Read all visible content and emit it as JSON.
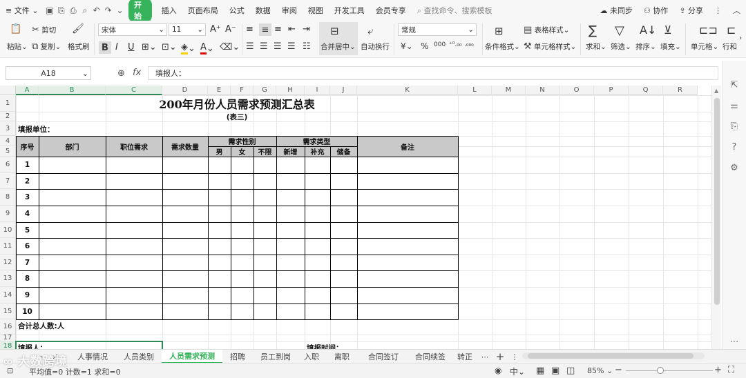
{
  "menu": {
    "file": "文件",
    "tabs": [
      "开始",
      "插入",
      "页面布局",
      "公式",
      "数据",
      "审阅",
      "视图",
      "开发工具",
      "会员专享"
    ],
    "search_placeholder": "查找命令、搜索模板",
    "right": [
      "未同步",
      "协作",
      "分享"
    ]
  },
  "ribbon": {
    "paste": "粘贴",
    "cut": "剪切",
    "copy": "复制",
    "format_painter": "格式刷",
    "font_name": "宋体",
    "font_size": "11",
    "merge_center": "合并居中",
    "wrap_text": "自动换行",
    "number_format": "常规",
    "cond_format": "条件格式",
    "table_style": "表格样式",
    "cell_style": "单元格样式",
    "sum": "求和",
    "filter": "筛选",
    "sort": "排序",
    "fill": "填充",
    "cell": "单元格",
    "row_col": "行和"
  },
  "formula": {
    "cell_ref": "A18",
    "fx": "fx",
    "content": "填报人："
  },
  "columns": [
    "A",
    "B",
    "C",
    "D",
    "E",
    "F",
    "G",
    "H",
    "I",
    "J",
    "K",
    "L",
    "M",
    "N",
    "O",
    "P",
    "Q",
    "R"
  ],
  "rows": [
    "1",
    "2",
    "3",
    "4",
    "5",
    "6",
    "7",
    "8",
    "9",
    "10",
    "11",
    "12",
    "13",
    "14",
    "15",
    "16",
    "17",
    "18"
  ],
  "sheet": {
    "title": "200年月份人员需求预测汇总表",
    "subtitle": "(表三)",
    "reporting_unit": "填报单位：",
    "headers": {
      "seq": "序号",
      "dept": "部门",
      "position": "职位需求",
      "quantity": "需求数量",
      "gender": "需求性别",
      "male": "男",
      "female": "女",
      "unlimited": "不限",
      "type": "需求类型",
      "new": "新增",
      "supplement": "补充",
      "reserve": "储备",
      "remark": "备注"
    },
    "seq_numbers": [
      "1",
      "2",
      "3",
      "4",
      "5",
      "6",
      "7",
      "8",
      "9",
      "10"
    ],
    "total": "合计总人数:人",
    "reporter": "填报人：",
    "report_time": "填报时间："
  },
  "sheet_tabs": [
    "人事情况",
    "人员类别",
    "人员需求预测",
    "招聘",
    "员工到岗",
    "入职",
    "离职",
    "合同签订",
    "合同续签",
    "转正"
  ],
  "active_tab": "人员需求预测",
  "status": {
    "summary": "平均值=0  计数=1  求和=0",
    "zoom": "85%"
  },
  "watermark": "大数跨境"
}
